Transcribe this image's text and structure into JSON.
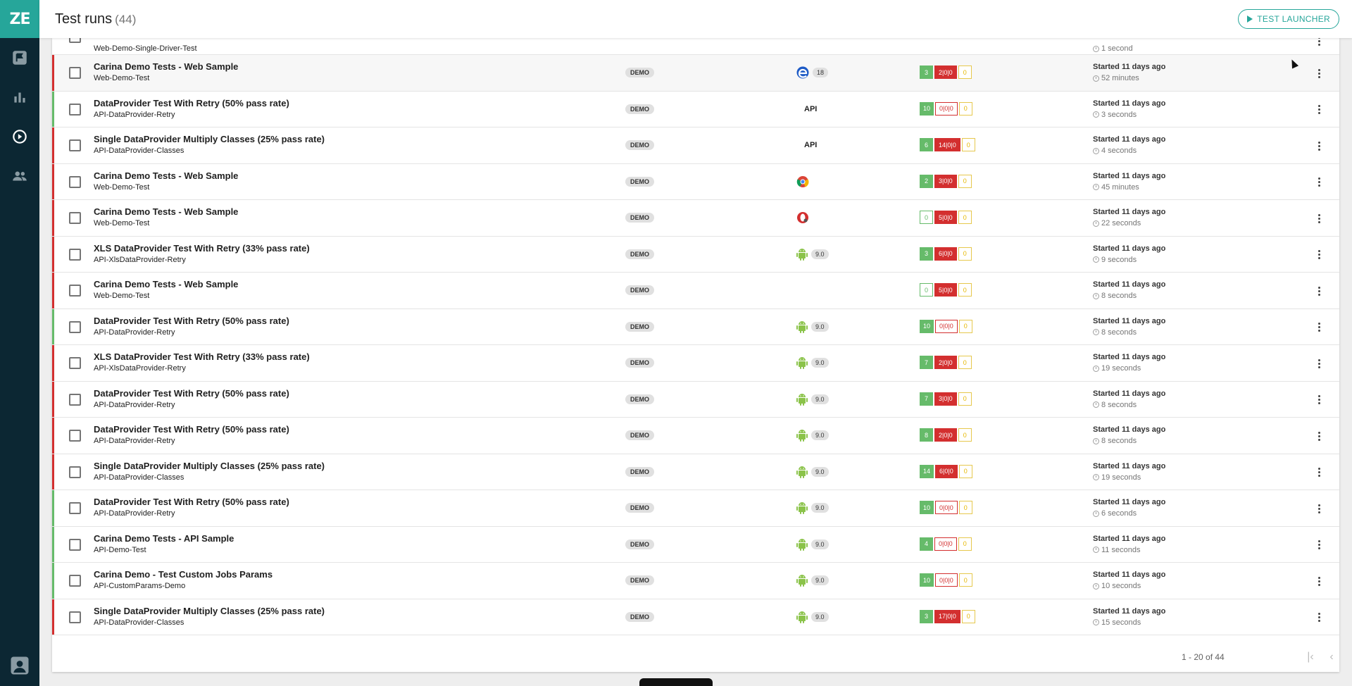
{
  "header": {
    "title": "Test runs",
    "count": "(44)",
    "launcher_label": "TEST LAUNCHER"
  },
  "sidebar": {
    "logo": "ZE",
    "items": [
      {
        "icon": "flag-icon"
      },
      {
        "icon": "bar-chart-icon"
      },
      {
        "icon": "play-circle-icon"
      },
      {
        "icon": "people-icon"
      }
    ],
    "bottom_icon": "user-avatar-icon"
  },
  "partial_row": {
    "job": "Web-Demo-Single-Driver-Test",
    "elapsed": "1 second"
  },
  "rows": [
    {
      "status": "fail",
      "name": "Carina Demo Tests - Web Sample",
      "job": "Web-Demo-Test",
      "env": "DEMO",
      "platform": "edge",
      "version": "18",
      "passed": "3",
      "failed": "2|0|0",
      "skipped": "0",
      "started": "Started 11 days ago",
      "elapsed": "52 minutes"
    },
    {
      "status": "pass",
      "name": "DataProvider Test With Retry (50% pass rate)",
      "job": "API-DataProvider-Retry",
      "env": "DEMO",
      "platform": "api",
      "version": "",
      "passed": "10",
      "failed": "0|0|0",
      "skipped": "0",
      "started": "Started 11 days ago",
      "elapsed": "3 seconds"
    },
    {
      "status": "fail",
      "name": "Single DataProvider Multiply Classes (25% pass rate)",
      "job": "API-DataProvider-Classes",
      "env": "DEMO",
      "platform": "api",
      "version": "",
      "passed": "6",
      "failed": "14|0|0",
      "skipped": "0",
      "started": "Started 11 days ago",
      "elapsed": "4 seconds"
    },
    {
      "status": "fail",
      "name": "Carina Demo Tests - Web Sample",
      "job": "Web-Demo-Test",
      "env": "DEMO",
      "platform": "chrome",
      "version": "",
      "passed": "2",
      "failed": "3|0|0",
      "skipped": "0",
      "started": "Started 11 days ago",
      "elapsed": "45 minutes"
    },
    {
      "status": "fail",
      "name": "Carina Demo Tests - Web Sample",
      "job": "Web-Demo-Test",
      "env": "DEMO",
      "platform": "opera",
      "version": "",
      "passed": "0",
      "failed": "5|0|0",
      "skipped": "0",
      "started": "Started 11 days ago",
      "elapsed": "22 seconds"
    },
    {
      "status": "fail",
      "name": "XLS DataProvider Test With Retry (33% pass rate)",
      "job": "API-XlsDataProvider-Retry",
      "env": "DEMO",
      "platform": "android",
      "version": "9.0",
      "passed": "3",
      "failed": "6|0|0",
      "skipped": "0",
      "started": "Started 11 days ago",
      "elapsed": "9 seconds"
    },
    {
      "status": "fail",
      "name": "Carina Demo Tests - Web Sample",
      "job": "Web-Demo-Test",
      "env": "DEMO",
      "platform": "none",
      "version": "",
      "passed": "0",
      "failed": "5|0|0",
      "skipped": "0",
      "started": "Started 11 days ago",
      "elapsed": "8 seconds"
    },
    {
      "status": "pass",
      "name": "DataProvider Test With Retry (50% pass rate)",
      "job": "API-DataProvider-Retry",
      "env": "DEMO",
      "platform": "android",
      "version": "9.0",
      "passed": "10",
      "failed": "0|0|0",
      "skipped": "0",
      "started": "Started 11 days ago",
      "elapsed": "8 seconds"
    },
    {
      "status": "fail",
      "name": "XLS DataProvider Test With Retry (33% pass rate)",
      "job": "API-XlsDataProvider-Retry",
      "env": "DEMO",
      "platform": "android",
      "version": "9.0",
      "passed": "7",
      "failed": "2|0|0",
      "skipped": "0",
      "started": "Started 11 days ago",
      "elapsed": "19 seconds"
    },
    {
      "status": "fail",
      "name": "DataProvider Test With Retry (50% pass rate)",
      "job": "API-DataProvider-Retry",
      "env": "DEMO",
      "platform": "android",
      "version": "9.0",
      "passed": "7",
      "failed": "3|0|0",
      "skipped": "0",
      "started": "Started 11 days ago",
      "elapsed": "8 seconds"
    },
    {
      "status": "fail",
      "name": "DataProvider Test With Retry (50% pass rate)",
      "job": "API-DataProvider-Retry",
      "env": "DEMO",
      "platform": "android",
      "version": "9.0",
      "passed": "8",
      "failed": "2|0|0",
      "skipped": "0",
      "started": "Started 11 days ago",
      "elapsed": "8 seconds"
    },
    {
      "status": "fail",
      "name": "Single DataProvider Multiply Classes (25% pass rate)",
      "job": "API-DataProvider-Classes",
      "env": "DEMO",
      "platform": "android",
      "version": "9.0",
      "passed": "14",
      "failed": "6|0|0",
      "skipped": "0",
      "started": "Started 11 days ago",
      "elapsed": "19 seconds"
    },
    {
      "status": "pass",
      "name": "DataProvider Test With Retry (50% pass rate)",
      "job": "API-DataProvider-Retry",
      "env": "DEMO",
      "platform": "android",
      "version": "9.0",
      "passed": "10",
      "failed": "0|0|0",
      "skipped": "0",
      "started": "Started 11 days ago",
      "elapsed": "6 seconds"
    },
    {
      "status": "pass",
      "name": "Carina Demo Tests - API Sample",
      "job": "API-Demo-Test",
      "env": "DEMO",
      "platform": "android",
      "version": "9.0",
      "passed": "4",
      "failed": "0|0|0",
      "skipped": "0",
      "started": "Started 11 days ago",
      "elapsed": "11 seconds"
    },
    {
      "status": "pass",
      "name": "Carina Demo - Test Custom Jobs Params",
      "job": "API-CustomParams-Demo",
      "env": "DEMO",
      "platform": "android",
      "version": "9.0",
      "passed": "10",
      "failed": "0|0|0",
      "skipped": "0",
      "started": "Started 11 days ago",
      "elapsed": "10 seconds"
    },
    {
      "status": "fail",
      "name": "Single DataProvider Multiply Classes (25% pass rate)",
      "job": "API-DataProvider-Classes",
      "env": "DEMO",
      "platform": "android",
      "version": "9.0",
      "passed": "3",
      "failed": "17|0|0",
      "skipped": "0",
      "started": "Started 11 days ago",
      "elapsed": "15 seconds"
    }
  ],
  "pagination": {
    "range_text": "1 - 20 of 44",
    "first_icon": "first-page-icon",
    "prev_icon": "chevron-left-icon",
    "next_icon": "chevron-right-icon",
    "last_icon": "last-page-icon"
  },
  "colors": {
    "accent": "#26a69a",
    "sidebar": "#0c2733",
    "pass": "#66bb6a",
    "fail": "#d32f2f",
    "skip": "#e6b800"
  }
}
